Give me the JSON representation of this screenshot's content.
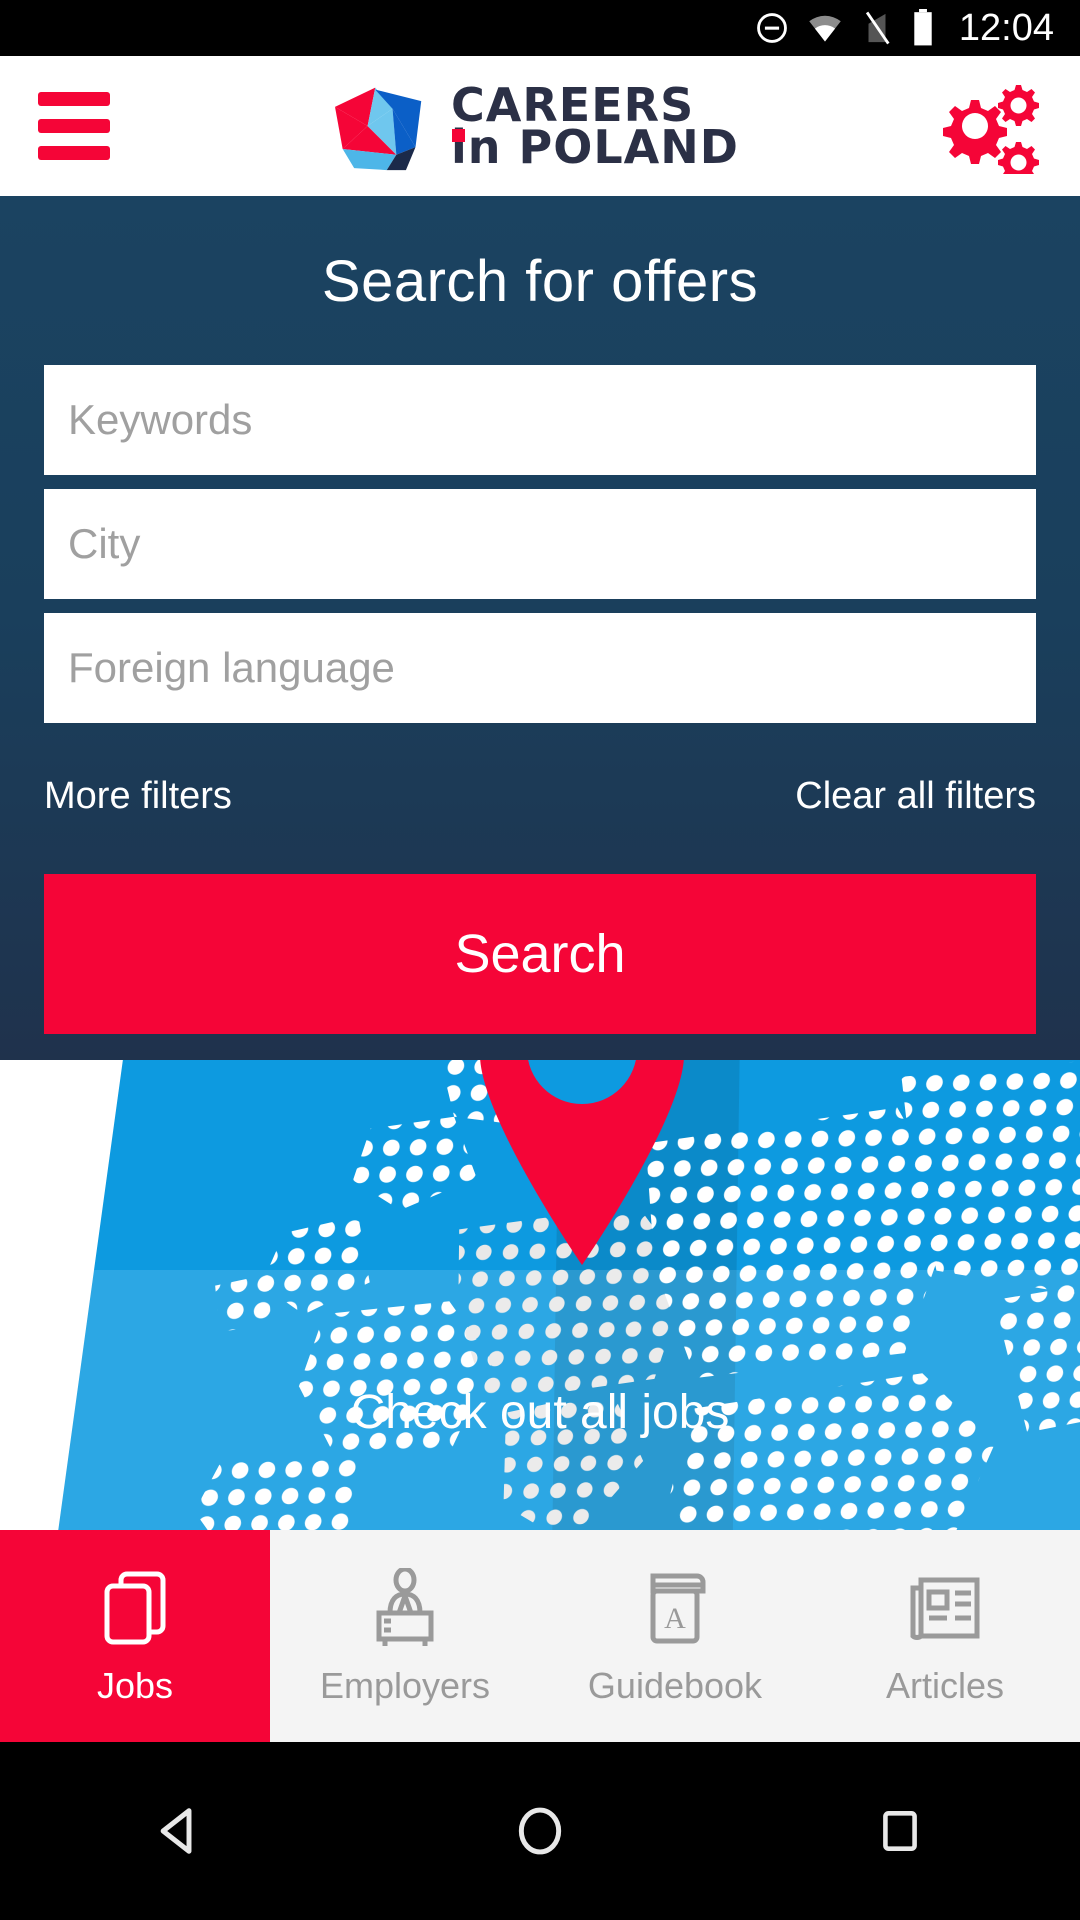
{
  "status_bar": {
    "time": "12:04",
    "icons": [
      "do-not-disturb-icon",
      "wifi-icon",
      "signal-off-icon",
      "battery-icon"
    ]
  },
  "header": {
    "menu_icon": "hamburger-menu-icon",
    "settings_icon": "gears-icon",
    "logo_line1": "CAREERS",
    "logo_line2": "in POLAND",
    "logo_line2_prefix": "in",
    "logo_line2_main": " POLAND"
  },
  "search": {
    "title": "Search for offers",
    "keywords_placeholder": "Keywords",
    "keywords_value": "",
    "city_placeholder": "City",
    "city_value": "",
    "language_placeholder": "Foreign language",
    "language_value": "",
    "more_filters_label": "More filters",
    "clear_filters_label": "Clear all filters",
    "search_button_label": "Search"
  },
  "hero": {
    "cta_label": "Check out all jobs",
    "pin_icon": "map-pin-icon"
  },
  "bottom_nav": {
    "items": [
      {
        "label": "Jobs",
        "icon": "jobs-cards-icon",
        "active": true
      },
      {
        "label": "Employers",
        "icon": "employer-desk-icon",
        "active": false
      },
      {
        "label": "Guidebook",
        "icon": "book-a-icon",
        "active": false
      },
      {
        "label": "Articles",
        "icon": "newspaper-icon",
        "active": false
      }
    ]
  },
  "android_nav": {
    "back": "back-triangle-icon",
    "home": "home-circle-icon",
    "recents": "recents-square-icon"
  },
  "colors": {
    "brand_red": "#f50537",
    "panel_navy": "#1a3f5c",
    "dark_navy": "#1c2237",
    "map_blue": "#0d9ae0",
    "logo_text": "#2b3046"
  }
}
